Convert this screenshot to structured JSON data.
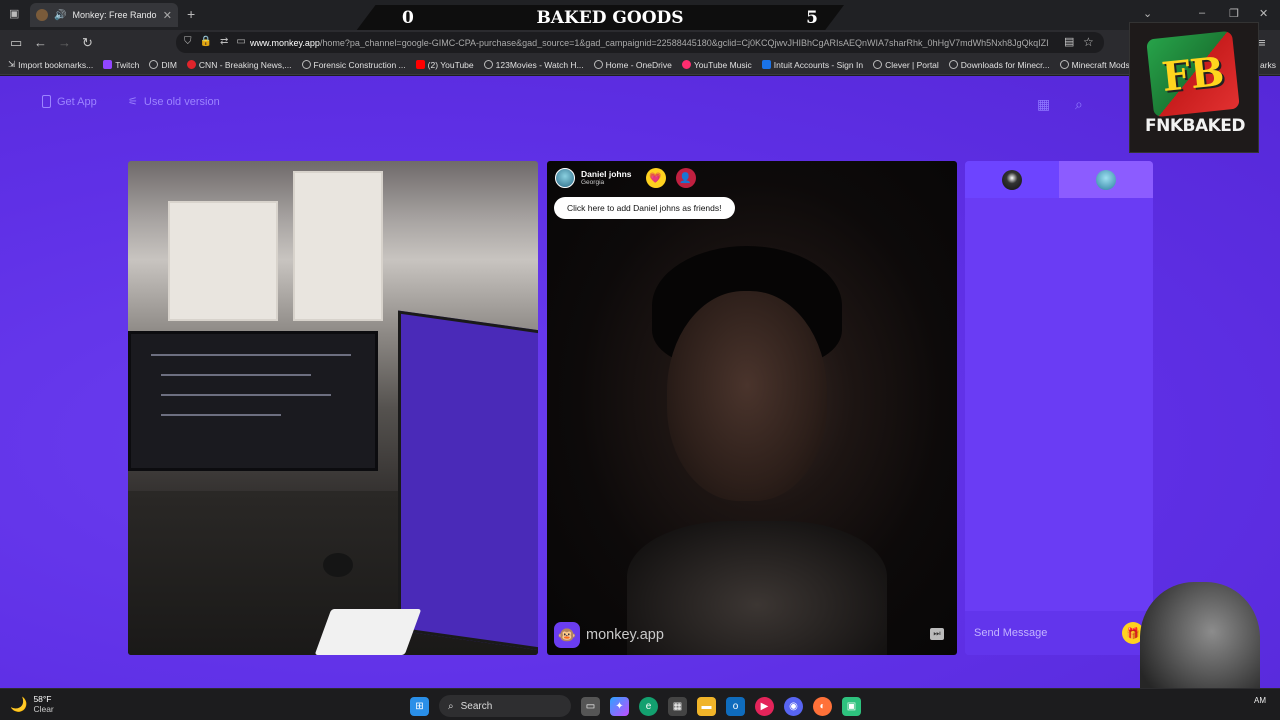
{
  "browser": {
    "tab_title": "Monkey: Free Random Vide",
    "new_tab_symbol": "+",
    "url_domain": "www.monkey.app",
    "url_rest": "/home?pa_channel=google-GIMC-CPA-purchase&gad_source=1&gad_campaignid=22588445180&gclid=Cj0KCQjwvJHIBhCgARIsAEQnWIA7sharRhk_0hHgV7mdWh5Nxh8JgQkqIZI",
    "bookmarks": [
      {
        "label": "Import bookmarks...",
        "icon": "import-icon"
      },
      {
        "label": "Twitch",
        "icon": "twitch-icon"
      },
      {
        "label": "DIM",
        "icon": "globe-icon"
      },
      {
        "label": "CNN - Breaking News,...",
        "icon": "cnn-icon"
      },
      {
        "label": "Forensic Construction ...",
        "icon": "globe-icon"
      },
      {
        "label": "(2) YouTube",
        "icon": "youtube-icon"
      },
      {
        "label": "123Movies - Watch H...",
        "icon": "globe-icon"
      },
      {
        "label": "Home - OneDrive",
        "icon": "globe-icon"
      },
      {
        "label": "YouTube Music",
        "icon": "youtube-music-icon"
      },
      {
        "label": "Intuit Accounts - Sign In",
        "icon": "intuit-icon"
      },
      {
        "label": "Clever | Portal",
        "icon": "globe-icon"
      },
      {
        "label": "Downloads for Minecr...",
        "icon": "globe-icon"
      },
      {
        "label": "Minecraft Mods - Curs...",
        "icon": "globe-icon"
      }
    ],
    "bookmarks_overflow": "arks"
  },
  "scoreboard": {
    "left_score": "0",
    "title": "BAKED GOODS",
    "right_score": "5"
  },
  "header": {
    "get_app": "Get App",
    "use_old_version": "Use old version"
  },
  "caller": {
    "name": "Daniel johns",
    "location": "Georgia",
    "add_friend": "Click here to add Daniel johns as friends!"
  },
  "brand": {
    "logo_text": "monkey.app"
  },
  "chat": {
    "placeholder": "Send Message"
  },
  "overlay_logo": {
    "mark": "FB",
    "text": "FNKBAKED"
  },
  "taskbar": {
    "temperature": "58°F",
    "condition": "Clear",
    "search_label": "Search",
    "clock_suffix": "AM"
  },
  "colors": {
    "page_bg": "#5f30e6",
    "chat_bg": "#6a3cf4",
    "accent_yellow": "#ffd21f"
  }
}
